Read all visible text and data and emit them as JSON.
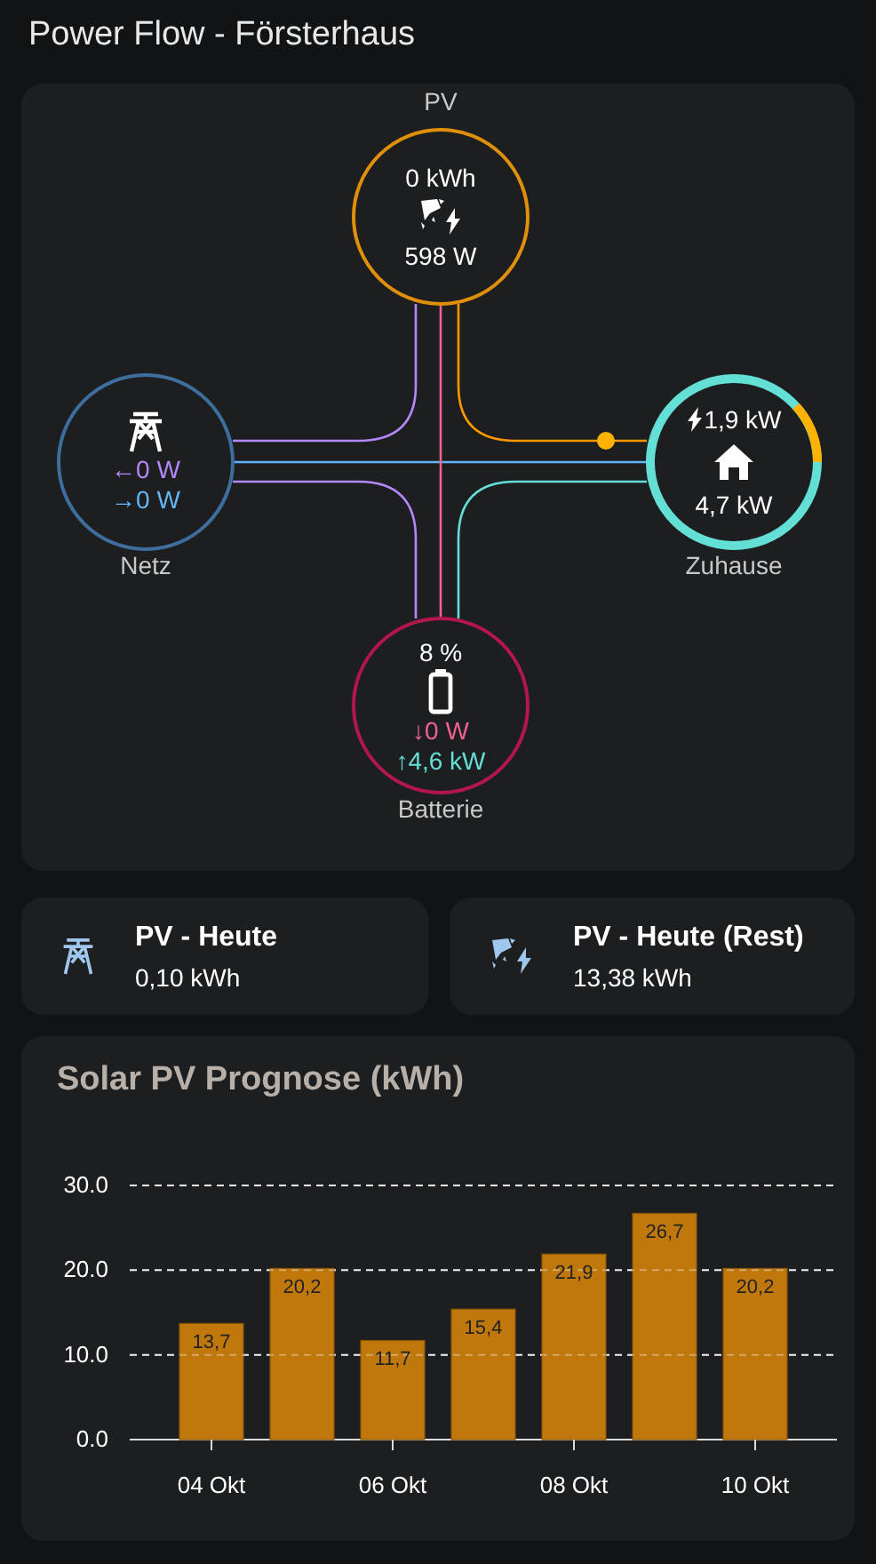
{
  "title": "Power Flow - Försterhaus",
  "flow": {
    "pv": {
      "label": "PV",
      "energy": "0 kWh",
      "power": "598 W"
    },
    "grid": {
      "label": "Netz",
      "readings": [
        {
          "arrow": "←",
          "value": "0 W",
          "color": "#b388ff"
        },
        {
          "arrow": "→",
          "value": "0 W",
          "color": "#64b5f6"
        }
      ]
    },
    "home": {
      "label": "Zuhause",
      "solar": "1,9 kW",
      "total": "4,7 kW"
    },
    "battery": {
      "label": "Batterie",
      "soc": "8 %",
      "readings": [
        {
          "arrow": "↓",
          "value": "0 W",
          "color": "#f06292"
        },
        {
          "arrow": "↑",
          "value": "4,6 kW",
          "color": "#64dfd5"
        }
      ]
    }
  },
  "tiles": [
    {
      "kind": "tower",
      "title": "PV - Heute",
      "value": "0,10 kWh"
    },
    {
      "kind": "solar",
      "title": "PV - Heute (Rest)",
      "value": "13,38 kWh"
    }
  ],
  "forecast": {
    "title": "Solar PV Prognose (kWh)",
    "chart_data": {
      "type": "bar",
      "values": [
        13.7,
        20.2,
        11.7,
        15.4,
        21.9,
        26.7,
        20.2
      ],
      "value_labels": [
        "13,7",
        "20,2",
        "11,7",
        "15,4",
        "21,9",
        "26,7",
        "20,2"
      ],
      "categories": [
        "04 Okt",
        null,
        "06 Okt",
        null,
        "08 Okt",
        null,
        "10 Okt"
      ],
      "grid": true,
      "yticks": [
        {
          "value": 0,
          "label": "0.0"
        },
        {
          "value": 10,
          "label": "10.0"
        },
        {
          "value": 20,
          "label": "20.0"
        },
        {
          "value": 30,
          "label": "30.0"
        }
      ],
      "ylim": [
        0,
        30
      ]
    }
  }
}
